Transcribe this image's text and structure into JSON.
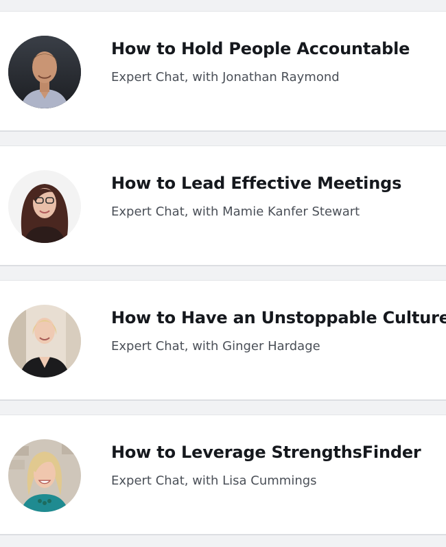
{
  "chats": [
    {
      "title": "How to Hold People Accountable",
      "subtitle": "Expert Chat, with Jonathan Raymond",
      "avatar_icon": "person-avatar-man",
      "colors": {
        "bg": "#2a2d33",
        "skin": "#c99574",
        "hair": "#6b4e35",
        "shirt": "#aeb4c8"
      }
    },
    {
      "title": "How to Lead Effective Meetings",
      "subtitle": "Expert Chat, with Mamie Kanfer Stewart",
      "avatar_icon": "person-avatar-woman",
      "colors": {
        "bg": "#f3f3f3",
        "skin": "#e9bfa9",
        "hair": "#4a2720",
        "shirt": "#2c1c1a"
      }
    },
    {
      "title": "How to Have an Unstoppable Culture",
      "subtitle": "Expert Chat, with Ginger Hardage",
      "avatar_icon": "person-avatar-woman",
      "colors": {
        "bg": "#e8ded2",
        "skin": "#efcab3",
        "hair": "#e7cc94",
        "shirt": "#1b1b1d"
      }
    },
    {
      "title": "How to Leverage StrengthsFinder",
      "subtitle": "Expert Chat, with Lisa Cummings",
      "avatar_icon": "person-avatar-woman",
      "colors": {
        "bg": "#cfc6ba",
        "skin": "#f0c7ae",
        "hair": "#e1c98f",
        "shirt": "#1f8b91"
      }
    }
  ]
}
